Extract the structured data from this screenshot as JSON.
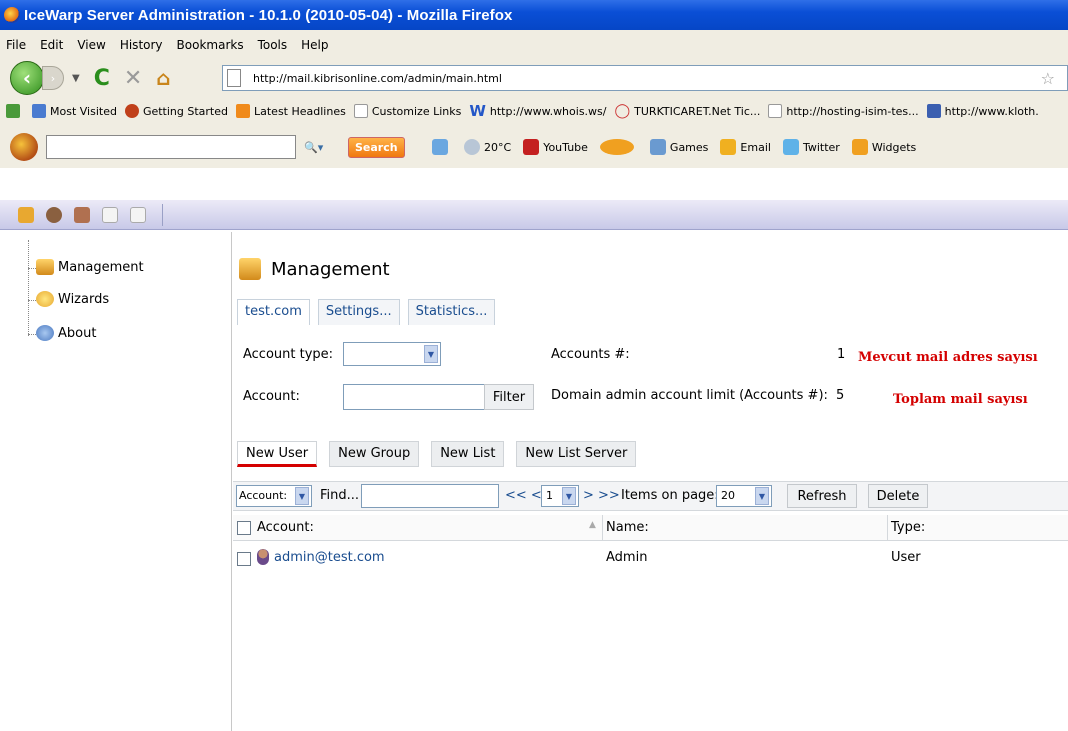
{
  "window": {
    "title": "IceWarp Server Administration - 10.1.0 (2010-05-04) - Mozilla Firefox"
  },
  "menu": [
    "File",
    "Edit",
    "View",
    "History",
    "Bookmarks",
    "Tools",
    "Help"
  ],
  "nav": {
    "url": "http://mail.kibrisonline.com/admin/main.html"
  },
  "bookmarks": [
    {
      "label": "Most Visited",
      "icon": "most-visited-icon",
      "color": "#4a7bd0"
    },
    {
      "label": "Getting Started",
      "icon": "firefox-icon",
      "color": "#c0401a"
    },
    {
      "label": "Latest Headlines",
      "icon": "rss-icon",
      "color": "#f08a1a"
    },
    {
      "label": "Customize Links",
      "icon": "page-icon",
      "color": "#ffffff"
    },
    {
      "label": "http://www.whois.ws/",
      "icon": "w-icon",
      "color": "#2457c8"
    },
    {
      "label": "TURKTICARET.Net Tic...",
      "icon": "ring-icon",
      "color": "#cc3333"
    },
    {
      "label": "http://hosting-isim-tes...",
      "icon": "page-icon",
      "color": "#ffffff"
    },
    {
      "label": "http://www.kloth.",
      "icon": "dl-icon",
      "color": "#3b5fb0"
    }
  ],
  "toolbar": {
    "search_label": "Search",
    "weather": "20°C",
    "youtube": "YouTube",
    "games": "Games",
    "email": "Email",
    "twitter": "Twitter",
    "widgets": "Widgets"
  },
  "tree": {
    "items": [
      "Management",
      "Wizards",
      "About"
    ]
  },
  "main": {
    "title": "Management",
    "tabs": [
      "test.com",
      "Settings...",
      "Statistics..."
    ],
    "account_type_label": "Account type:",
    "account_label": "Account:",
    "filter_label": "Filter",
    "accounts_count_label": "Accounts #:",
    "accounts_count_value": "1",
    "domain_limit_label": "Domain admin account limit (Accounts #):",
    "domain_limit_value": "5",
    "note_current": "Mevcut mail adres sayısı",
    "note_total": "Toplam mail sayısı",
    "new_buttons": [
      "New User",
      "New Group",
      "New List",
      "New List Server"
    ],
    "grid_bar": {
      "account_select": "Account:",
      "find_label": "Find...",
      "pager_prev": "<< <",
      "page": "1",
      "pager_next": "> >>",
      "items_label": "Items on page:",
      "items_value": "20",
      "refresh": "Refresh",
      "delete": "Delete"
    },
    "columns": [
      "Account:",
      "Name:",
      "Type:"
    ],
    "rows": [
      {
        "account": "admin@test.com",
        "name": "Admin",
        "type": "User"
      }
    ]
  }
}
